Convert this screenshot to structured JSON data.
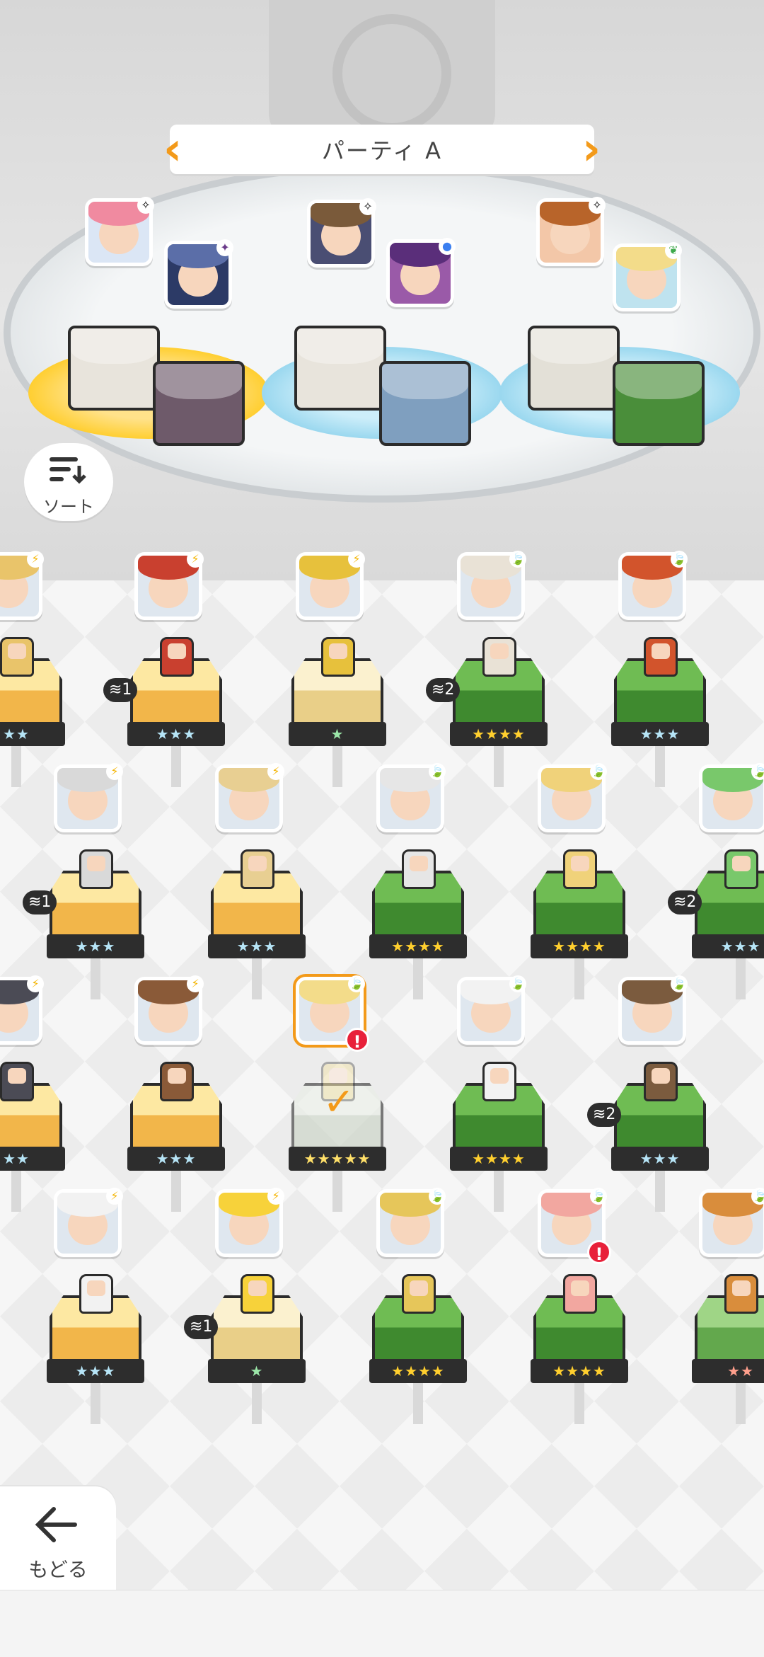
{
  "party": {
    "title": "パーティ A",
    "prev_icon": "chevron-left-icon",
    "next_icon": "chevron-right-icon"
  },
  "buttons": {
    "sort_label": "ソート",
    "back_label": "もどる"
  },
  "colors": {
    "accent": "#f39a1a",
    "alert": "#e8213a",
    "star_bar": "#2d2d2d"
  },
  "party_slots": [
    {
      "front_element": "sparkle",
      "back_element": "dark",
      "front_hair": "#f08aa0",
      "back_hair": "#5b6ea8",
      "pedestal": "yellow"
    },
    {
      "front_element": "sparkle",
      "back_element": "blue-dot",
      "front_hair": "#7a5a3a",
      "back_hair": "#5a2e7a",
      "pedestal": "blue"
    },
    {
      "front_element": "sparkle",
      "back_element": "leaf",
      "front_hair": "#b8642a",
      "back_hair": "#f3dc8a",
      "pedestal": "green"
    }
  ],
  "roster": [
    {
      "row": 1,
      "stars": "★★",
      "element": "⚡",
      "base": "yellow",
      "hair": "#e9c46a",
      "dup": "",
      "partial": true
    },
    {
      "row": 1,
      "stars": "★★★",
      "element": "⚡",
      "base": "yellow",
      "hair": "#c9402f",
      "dup": "1"
    },
    {
      "row": 1,
      "stars": "★",
      "element": "⚡",
      "base": "cream",
      "hair": "#e7c13c",
      "dup": ""
    },
    {
      "row": 1,
      "stars": "★★★★",
      "element": "🍃",
      "base": "green",
      "hair": "#e9e2d6",
      "dup": "2"
    },
    {
      "row": 1,
      "stars": "★★★",
      "element": "🍃",
      "base": "green",
      "hair": "#d2542c",
      "dup": ""
    },
    {
      "row": 2,
      "stars": "★★★",
      "element": "⚡",
      "base": "yellow",
      "hair": "#d9d9d9",
      "dup": "1"
    },
    {
      "row": 2,
      "stars": "★★★",
      "element": "⚡",
      "base": "yellow",
      "hair": "#e8cf92",
      "dup": ""
    },
    {
      "row": 2,
      "stars": "★★★★",
      "element": "🍃",
      "base": "green",
      "hair": "#e6e6e6",
      "dup": ""
    },
    {
      "row": 2,
      "stars": "★★★★",
      "element": "🍃",
      "base": "green",
      "hair": "#f0d27a",
      "dup": ""
    },
    {
      "row": 2,
      "stars": "★★★",
      "element": "🍃",
      "base": "green",
      "hair": "#79c86b",
      "dup": "2"
    },
    {
      "row": 3,
      "stars": "★★",
      "element": "⚡",
      "base": "yellow",
      "hair": "#4b4b55",
      "dup": "",
      "partial": true
    },
    {
      "row": 3,
      "stars": "★★★",
      "element": "⚡",
      "base": "yellow",
      "hair": "#8a5a38",
      "dup": ""
    },
    {
      "row": 3,
      "stars": "★★★★★",
      "element": "🍃",
      "base": "ghost",
      "hair": "#f3dc8a",
      "dup": "",
      "selected": true,
      "alert": "!"
    },
    {
      "row": 3,
      "stars": "★★★★",
      "element": "🍃",
      "base": "green",
      "hair": "#f2f2f2",
      "dup": ""
    },
    {
      "row": 3,
      "stars": "★★★",
      "element": "🍃",
      "base": "green",
      "hair": "#7b5b3e",
      "dup": "2"
    },
    {
      "row": 4,
      "stars": "★★★",
      "element": "⚡",
      "base": "yellow",
      "hair": "#f2f2f2",
      "dup": ""
    },
    {
      "row": 4,
      "stars": "★",
      "element": "⚡",
      "base": "cream",
      "hair": "#f7d23a",
      "dup": "1"
    },
    {
      "row": 4,
      "stars": "★★★★",
      "element": "🍃",
      "base": "green",
      "hair": "#e6c65a",
      "dup": ""
    },
    {
      "row": 4,
      "stars": "★★★★",
      "element": "🍃",
      "base": "green",
      "hair": "#f2a7a0",
      "dup": "",
      "alert": "!"
    },
    {
      "row": 4,
      "stars": "★★",
      "element": "🍃",
      "base": "lightgreen",
      "hair": "#d98d3c",
      "dup": ""
    }
  ]
}
